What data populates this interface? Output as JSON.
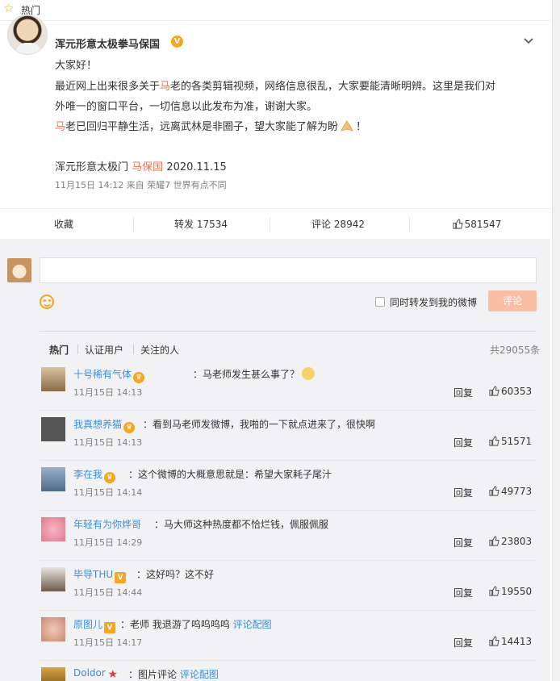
{
  "topbar": {
    "label": "热门"
  },
  "post": {
    "author": "浑元形意太极拳马保国",
    "v_badge": "V",
    "greeting": "大家好！",
    "line1": "最近网上出来很多关于",
    "line1_red": "马",
    "line1_rest": "老的各类剪辑视频，网络信息很乱，大家要能清晰明辨。这里是我们对",
    "line2": "外唯一的窗口平台，一切信息以此发布为准，谢谢大家。",
    "line3_red": "马",
    "line3": "老已回归平静生活，远离武林是非圈子，望大家能了解为盼",
    "line3_end": "！",
    "sign_prefix": "浑元形意太极门",
    "sign_red": "马保国",
    "sign_date": "2020.11.15",
    "meta": "11月15日 14:12  来自 荣耀7 世界有点不同"
  },
  "actions": {
    "collect": "收藏",
    "repost": "转发 17534",
    "comment": "评论 28942",
    "like": "581547"
  },
  "composer": {
    "also_repost": "同时转发到我的微博",
    "submit": "评论"
  },
  "tabs": {
    "hot": "热门",
    "verified": "认证用户",
    "following": "关注的人",
    "total": "共29055条"
  },
  "comments": [
    {
      "name": "十号稀有气体",
      "badge": "crown",
      "text": "：马老师发生甚么事了？",
      "time": "11月15日 14:13",
      "reply": "回复",
      "likes": "60353"
    },
    {
      "name": "我真想养猫",
      "badge": "crown",
      "text": "：看到马老师发微博，我啪的一下就点进来了，很快啊",
      "time": "11月15日 14:13",
      "reply": "回复",
      "likes": "51571"
    },
    {
      "name": "李在我",
      "badge": "crown",
      "text": "：这个微博的大概意思就是：希望大家耗子尾汁",
      "time": "11月15日 14:14",
      "reply": "回复",
      "likes": "49773"
    },
    {
      "name": "年轻有为你烨哥",
      "badge": "",
      "text": "：马大师这种热度都不恰烂钱，佩服佩服",
      "time": "11月15日 14:29",
      "reply": "回复",
      "likes": "23803"
    },
    {
      "name": "毕导THU",
      "badge": "V",
      "text": "：这好吗？这不好",
      "time": "11月15日 14:44",
      "reply": "回复",
      "likes": "19550"
    },
    {
      "name": "原图儿",
      "badge": "V",
      "text": "：老师 我退游了呜呜呜呜",
      "link": "评论配图",
      "time": "11月15日 14:17",
      "reply": "回复",
      "likes": "14413"
    },
    {
      "name": "Doldor",
      "badge": "star",
      "text": "：图片评论",
      "link": "评论配图",
      "time": "",
      "reply": "",
      "likes": ""
    }
  ],
  "colors": {
    "accent": "#eb7350",
    "link": "#3c8ed8",
    "badge_gold": "#f5a623"
  }
}
